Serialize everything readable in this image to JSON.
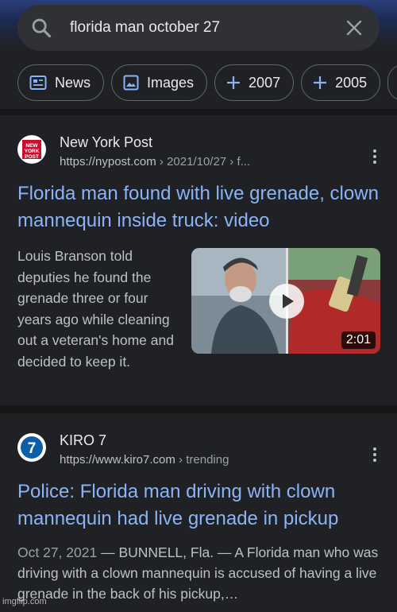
{
  "search": {
    "query": "florida man october 27"
  },
  "chips": [
    {
      "label": "News",
      "icon": "news-icon"
    },
    {
      "label": "Images",
      "icon": "image-icon"
    },
    {
      "label": "2007",
      "icon": "plus-icon"
    },
    {
      "label": "2005",
      "icon": "plus-icon"
    }
  ],
  "results": [
    {
      "source": "New York Post",
      "favicon_text": "NEW YORK POST",
      "url": "https://nypost.com",
      "path": " › 2021/10/27 › f...",
      "title": "Florida man found with live grenade, clown mannequin inside truck: video",
      "snippet": "Louis Branson told deputies he found the grenade three or four years ago while cleaning out a veteran's home and decided to keep it.",
      "video_duration": "2:01"
    },
    {
      "source": "KIRO 7",
      "favicon_text": "7",
      "url": "https://www.kiro7.com",
      "path": " › trending",
      "title": "Police: Florida man driving with clown mannequin had live grenade in pickup",
      "date": "Oct 27, 2021",
      "snippet": " — BUNNELL, Fla. — A Florida man who was driving with a clown mannequin is accused of having a live grenade in the back of his pickup,…"
    }
  ],
  "watermark": "imgflip.com",
  "colors": {
    "background": "#202124",
    "link": "#8ab4f8",
    "accent_nypost": "#c8102e",
    "accent_kiro": "#0b5ea8"
  }
}
